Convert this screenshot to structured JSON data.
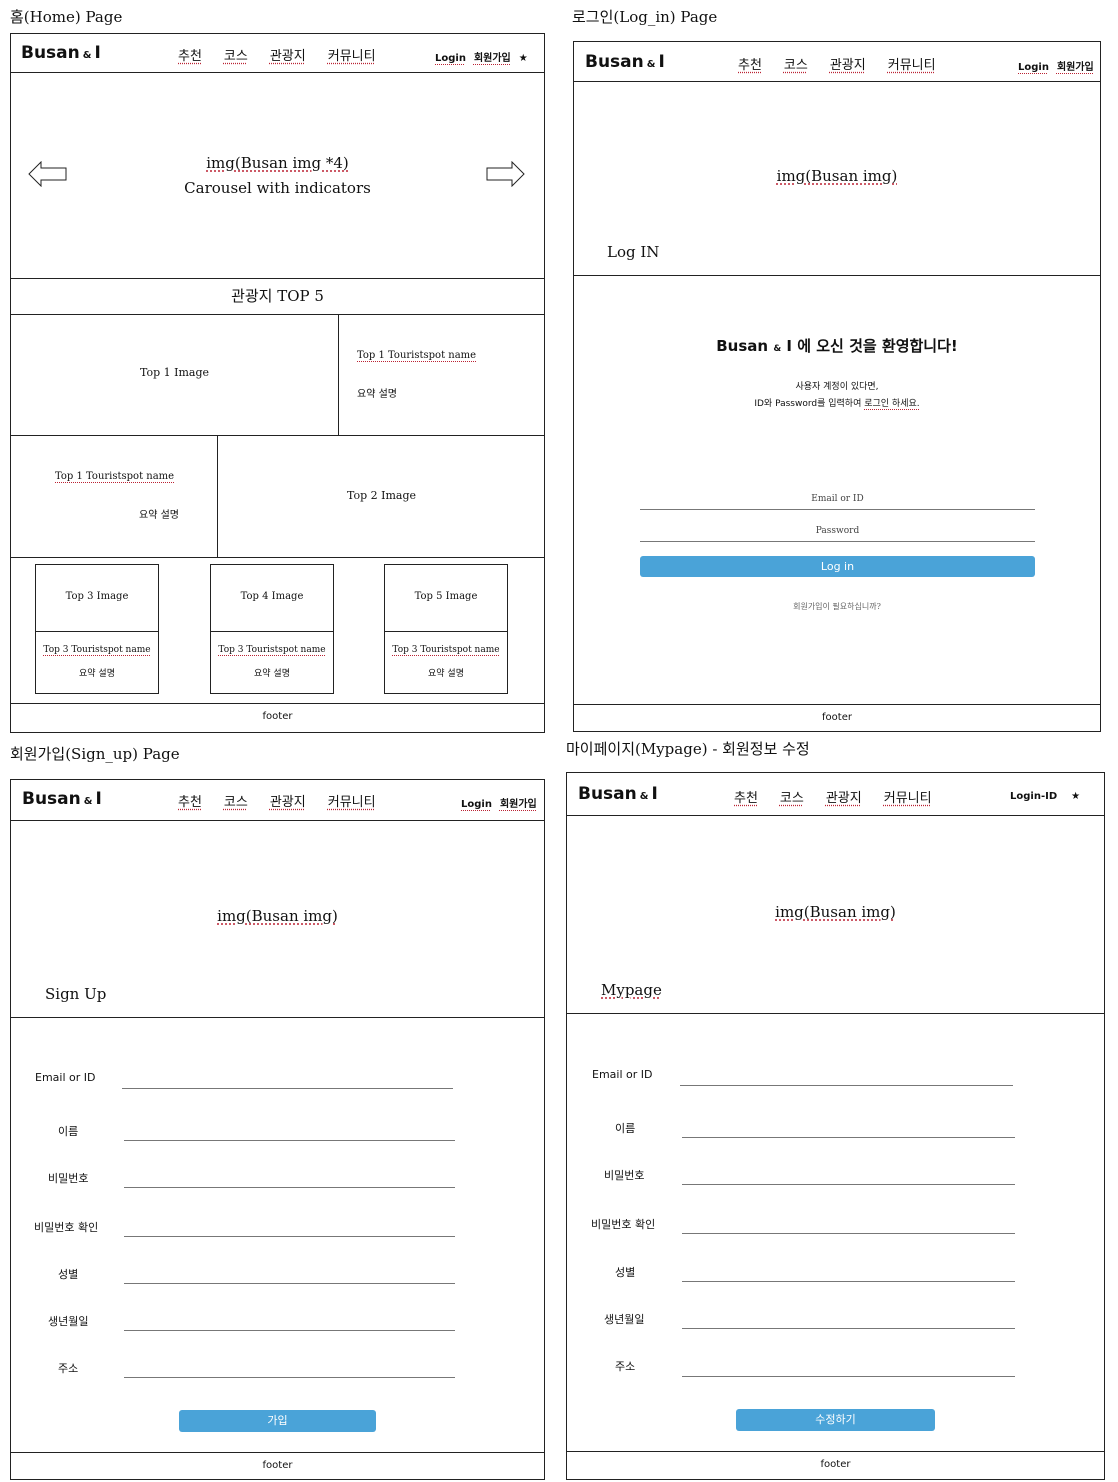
{
  "captions": {
    "home": "홈(Home) Page",
    "login": "로그인(Log_in) Page",
    "signup": "회원가입(Sign_up) Page",
    "mypage": "마이페이지(Mypage) - 회원정보 수정"
  },
  "header": {
    "brand_main": "Busan",
    "brand_amp": "&",
    "brand_tail": "I",
    "nav": [
      "추천",
      "코스",
      "관광지",
      "커뮤니티"
    ],
    "login": "Login",
    "signup": "회원가입",
    "star": "★",
    "login_id": "Login-ID"
  },
  "home": {
    "carousel_line1": "img(Busan img *4)",
    "carousel_line2": "Carousel with indicators",
    "top5_title": "관광지 TOP 5",
    "top1_image": "Top 1 Image",
    "top1_name": "Top 1 Touristspot name",
    "top1_desc": "요약 설명",
    "top2_name": "Top 1 Touristspot name",
    "top2_desc": "요약 설명",
    "top2_image": "Top 2 Image",
    "cards": [
      {
        "image": "Top 3 Image",
        "name": "Top 3 Touristspot name",
        "desc": "요약 설명"
      },
      {
        "image": "Top 4 Image",
        "name": "Top 3 Touristspot name",
        "desc": "요약 설명"
      },
      {
        "image": "Top 5 Image",
        "name": "Top 3 Touristspot name",
        "desc": "요약 설명"
      }
    ],
    "footer": "footer"
  },
  "login": {
    "hero": "img(Busan img)",
    "page_title": "Log IN",
    "welcome_prefix": "Busan",
    "welcome_amp": "&",
    "welcome_rest": "I 에 오신 것을 환영합니다!",
    "sub1": "사용자 계정이 있다면,",
    "sub2_a": "ID와 Password를 입력하여 ",
    "sub2_b": "로그인 하세요.",
    "email_placeholder": "Email or ID",
    "password_placeholder": "Password",
    "button": "Log in",
    "signup_link": "회원가입이 필요하십니까?",
    "footer": "footer"
  },
  "signup": {
    "hero": "img(Busan img)",
    "page_title": "Sign Up",
    "fields": [
      "Email or ID",
      "이름",
      "비밀번호",
      "비밀번호 확인",
      "성별",
      "생년월일",
      "주소"
    ],
    "button": "가입",
    "footer": "footer"
  },
  "mypage": {
    "hero": "img(Busan img)",
    "page_title": "Mypage",
    "fields": [
      "Email or ID",
      "이름",
      "비밀번호",
      "비밀번호 확인",
      "성별",
      "생년월일",
      "주소"
    ],
    "button": "수정하기",
    "footer": "footer"
  }
}
